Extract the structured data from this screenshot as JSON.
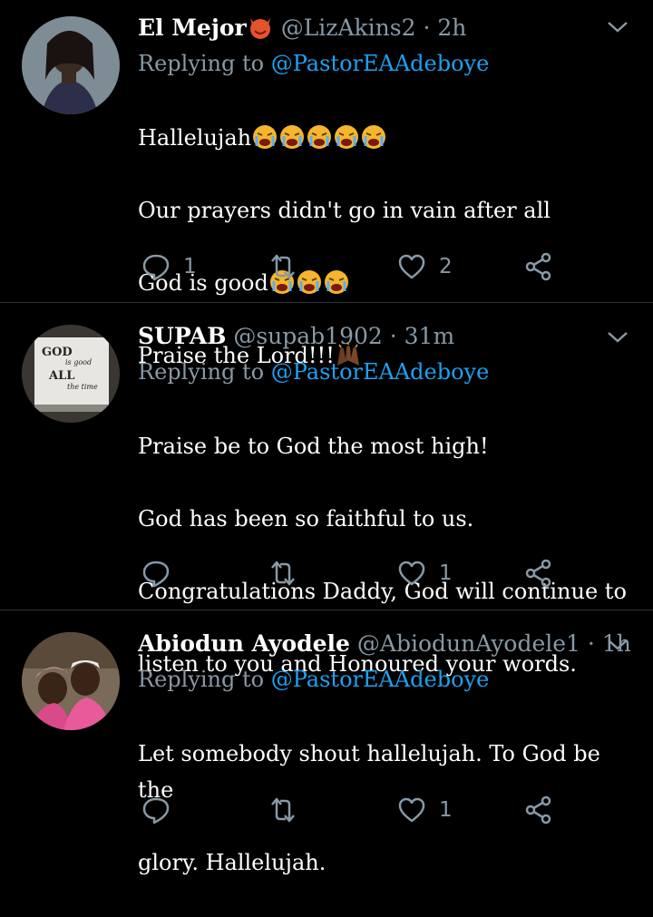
{
  "tweets": [
    {
      "name": "El Mejor",
      "handle": "@LizAkins2",
      "dot": "·",
      "time": "2h",
      "replying_prefix": "Replying to",
      "replying_to": "@PastorEAAdeboye",
      "lines": [
        {
          "text": "Hallelujah",
          "emoji": [
            "sob",
            "sob",
            "sob",
            "sob",
            "sob"
          ]
        },
        {
          "text": "Our prayers didn't go in vain after all",
          "emoji": []
        },
        {
          "text": "God is good",
          "emoji": [
            "sob",
            "sob",
            "sob"
          ]
        },
        {
          "text": "Praise the Lord!!!",
          "emoji": [
            "raised-hands"
          ]
        }
      ],
      "reply_count": "1",
      "retweet_count": "",
      "like_count": "2"
    },
    {
      "name": "SUPAB",
      "handle": "@supab1902",
      "dot": "·",
      "time": "31m",
      "replying_prefix": "Replying to",
      "replying_to": "@PastorEAAdeboye",
      "avatar_text": [
        "GOD",
        "is good",
        "ALL",
        "the time"
      ],
      "lines": [
        {
          "text": "Praise be to God the most high!",
          "emoji": []
        },
        {
          "text": "God has been so faithful to us.",
          "emoji": []
        },
        {
          "text": "Congratulations Daddy, God will continue to",
          "emoji": []
        },
        {
          "text": "listen to you and Honoured your words.",
          "emoji": []
        }
      ],
      "reply_count": "",
      "retweet_count": "",
      "like_count": "1"
    },
    {
      "name": "Abiodun Ayodele",
      "handle": "@AbiodunAyodele1",
      "dot": "·",
      "time": "1h",
      "replying_prefix": "Replying to",
      "replying_to": "@PastorEAAdeboye",
      "lines": [
        {
          "text": "Let somebody shout hallelujah. To God be the",
          "emoji": []
        },
        {
          "text": "glory. Hallelujah.",
          "emoji": []
        }
      ],
      "reply_count": "",
      "retweet_count": "",
      "like_count": "1"
    }
  ],
  "colors": {
    "background": "#000000",
    "secondary_text": "#8899a6",
    "mention": "#1da1f2",
    "divider": "#2f3336"
  }
}
